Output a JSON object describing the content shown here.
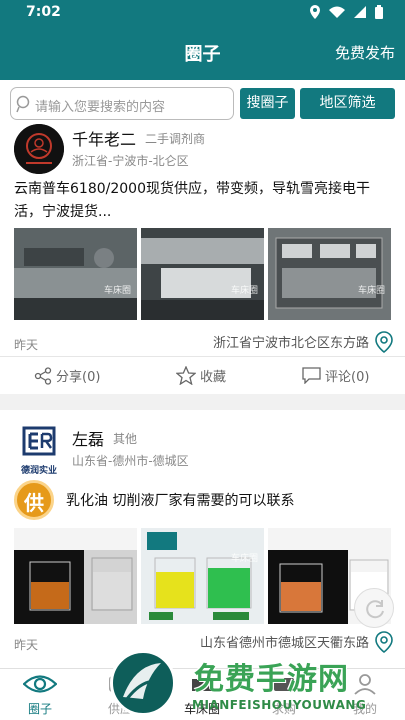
{
  "status": {
    "time": "7:02"
  },
  "header": {
    "title": "圈子",
    "publish": "免费发布"
  },
  "search": {
    "placeholder": "请输入您要搜索的内容",
    "search_button": "搜圈子",
    "region_button": "地区筛选"
  },
  "posts": [
    {
      "name": "千年老二",
      "tag": "二手调剂商",
      "location": "浙江省-宁波市-北仑区",
      "text": "云南普车6180/2000现货供应，带变频，导轨雪亮接电干活，宁波提货...",
      "photo_watermark": "车床圈",
      "time": "昨天",
      "address": "浙江省宁波市北仑区东方路",
      "share": "分享(0)",
      "favorite": "收藏",
      "comment": "评论(0)"
    },
    {
      "name": "左磊",
      "tag": "其他",
      "location": "山东省-德州市-德城区",
      "logo_text": "德润实业",
      "badge": "供",
      "text": "乳化油 切削液厂家有需要的可以联系",
      "photo_watermark": "车床圈",
      "time": "昨天",
      "address": "山东省德州市德城区天衢东路"
    }
  ],
  "nav": [
    {
      "label": "圈子",
      "icon": "eye-icon"
    },
    {
      "label": "供应",
      "icon": "supply-icon"
    },
    {
      "label": "车床圈",
      "icon": "lathe-icon"
    },
    {
      "label": "求购",
      "icon": "purchase-icon"
    },
    {
      "label": "我的",
      "icon": "profile-icon"
    }
  ],
  "overlay": {
    "title": "免费手游网",
    "subtitle": "MIANFEISHOUYOUWANG"
  },
  "colors": {
    "primary": "#12797f",
    "supply_badge": "#e69a1a",
    "watermark_green": "#3aa356"
  }
}
